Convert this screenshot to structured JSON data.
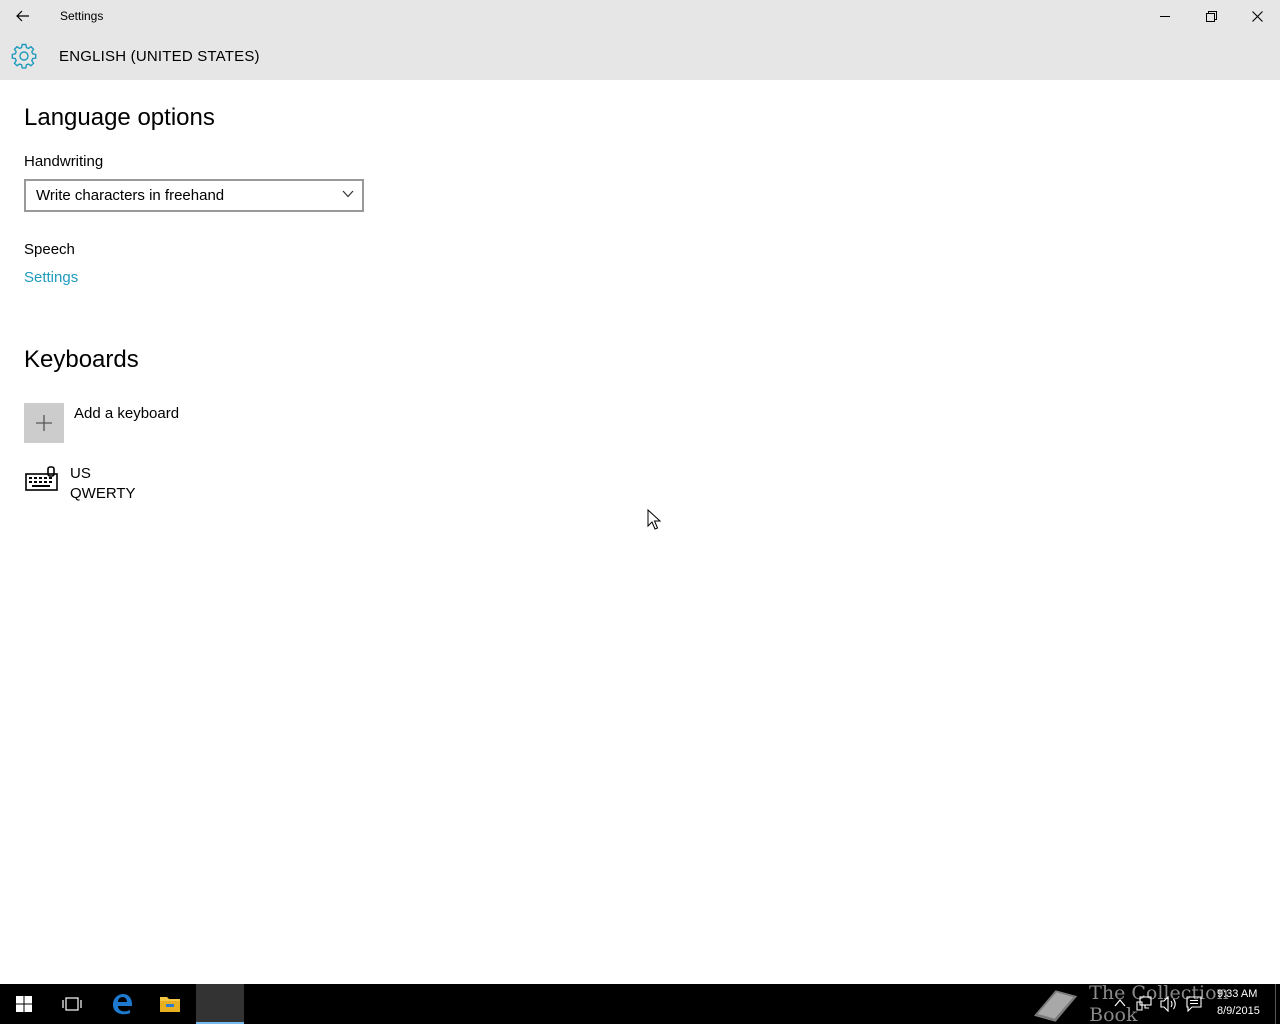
{
  "window": {
    "title": "Settings",
    "back_icon": "arrow-left-icon",
    "minimize_icon": "minimize-icon",
    "maximize_icon": "restore-icon",
    "close_icon": "close-icon"
  },
  "header": {
    "icon": "gear-icon",
    "title": "ENGLISH (UNITED STATES)"
  },
  "language_options": {
    "title": "Language options",
    "handwriting": {
      "label": "Handwriting",
      "selected": "Write characters in freehand"
    },
    "speech": {
      "label": "Speech",
      "link": "Settings"
    }
  },
  "keyboards": {
    "title": "Keyboards",
    "add_label": "Add a keyboard",
    "items": [
      {
        "name": "US",
        "layout": "QWERTY",
        "icon": "keyboard-icon"
      }
    ]
  },
  "taskbar": {
    "watermark": "The Collection Book",
    "time": "9:33 AM",
    "date": "8/9/2015"
  },
  "colors": {
    "accent": "#1f9bbd",
    "chrome": "#e6e6e6",
    "taskbar": "#000000"
  }
}
